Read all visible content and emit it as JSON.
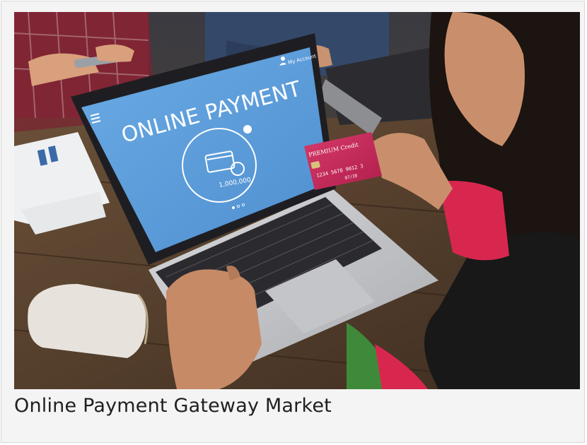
{
  "article": {
    "title": "Online Payment Gateway Market"
  },
  "photo": {
    "screen_headline": "ONLINE PAYMENT",
    "screen_account": "My Account",
    "screen_amount": "1,000,000",
    "card_title": "PREMIUM Credit",
    "card_number": "1234 5678 9012 3",
    "card_expiry": "07/28",
    "colors": {
      "screen_blue": "#5f9fdc",
      "card_pink": "#c92b5c",
      "sleeve_red": "#d8274f"
    }
  }
}
